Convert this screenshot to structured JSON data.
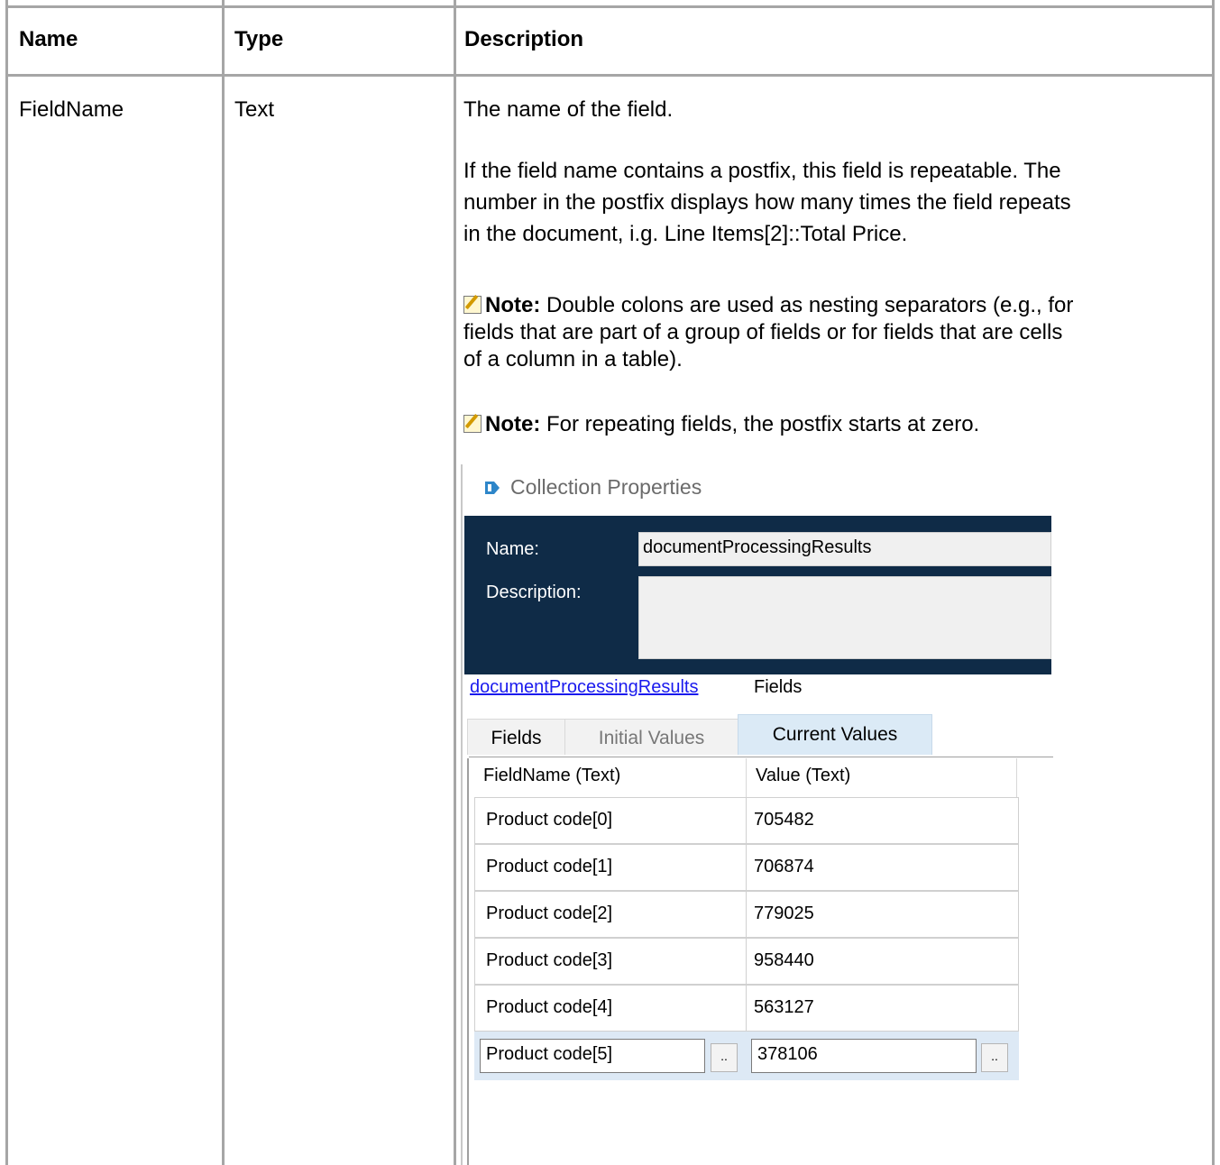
{
  "table": {
    "headers": [
      "Name",
      "Type",
      "Description"
    ],
    "row": {
      "name": "FieldName",
      "type": "Text",
      "description": {
        "p1": "The name of the field.",
        "p2_line1": "If the field name contains a postfix, this field is repeatable. The",
        "p2_line2": "number in the postfix displays how many times the field repeats",
        "p2_line3": "in the document, i.g. Line Items[2]::Total Price.",
        "note_label": "Note:",
        "note1_line1": "Double colons are used as nesting separators (e.g., for",
        "note1_line2": "fields that are part of a group of fields or for fields that are cells",
        "note1_line3": "of a column in a table).",
        "note2": "For repeating fields, the postfix starts at zero."
      }
    }
  },
  "screenshot": {
    "title": "Collection Properties",
    "name_label": "Name:",
    "name_value": "documentProcessingResults",
    "description_label": "Description:",
    "description_value": "",
    "breadcrumb_link": "documentProcessingResults",
    "breadcrumb_current": "Fields",
    "tabs": [
      "Fields",
      "Initial Values",
      "Current Values"
    ],
    "grid_headers": [
      "FieldName  (Text)",
      "Value  (Text)"
    ],
    "rows": [
      {
        "field": "Product code[0]",
        "value": "705482"
      },
      {
        "field": "Product code[1]",
        "value": "706874"
      },
      {
        "field": "Product code[2]",
        "value": "779025"
      },
      {
        "field": "Product code[3]",
        "value": "958440"
      },
      {
        "field": "Product code[4]",
        "value": "563127"
      }
    ],
    "editing_row": {
      "field": "Product code[5]",
      "value": "378106"
    },
    "ellipsis": ".."
  }
}
